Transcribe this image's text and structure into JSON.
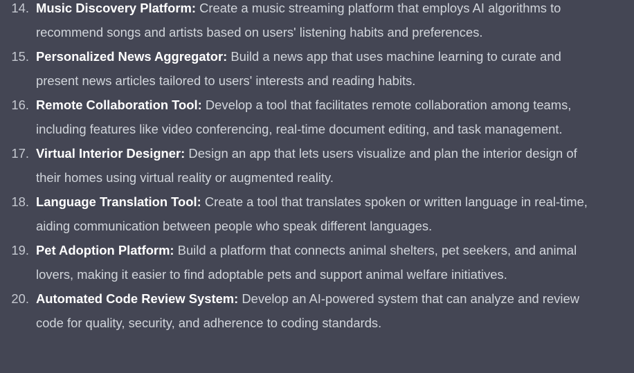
{
  "items": [
    {
      "number": "14.",
      "title": "Music Discovery Platform:",
      "description": "Create a music streaming platform that employs AI algorithms to recommend songs and artists based on users' listening habits and preferences."
    },
    {
      "number": "15.",
      "title": "Personalized News Aggregator:",
      "description": "Build a news app that uses machine learning to curate and present news articles tailored to users' interests and reading habits."
    },
    {
      "number": "16.",
      "title": "Remote Collaboration Tool:",
      "description": "Develop a tool that facilitates remote collaboration among teams, including features like video conferencing, real-time document editing, and task management."
    },
    {
      "number": "17.",
      "title": "Virtual Interior Designer:",
      "description": "Design an app that lets users visualize and plan the interior design of their homes using virtual reality or augmented reality."
    },
    {
      "number": "18.",
      "title": "Language Translation Tool:",
      "description": "Create a tool that translates spoken or written language in real-time, aiding communication between people who speak different languages."
    },
    {
      "number": "19.",
      "title": "Pet Adoption Platform:",
      "description": "Build a platform that connects animal shelters, pet seekers, and animal lovers, making it easier to find adoptable pets and support animal welfare initiatives."
    },
    {
      "number": "20.",
      "title": "Automated Code Review System:",
      "description": "Develop an AI-powered system that can analyze and review code for quality, security, and adherence to coding standards."
    }
  ]
}
